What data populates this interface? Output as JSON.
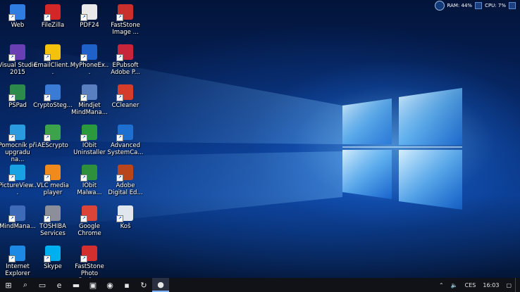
{
  "desktop_icons": [
    {
      "label": "Web",
      "icon": "globe-icon",
      "color": "#2f7de1"
    },
    {
      "label": "FileZilla",
      "icon": "filezilla-icon",
      "color": "#d32626"
    },
    {
      "label": "PDF24",
      "icon": "pdf24-icon",
      "color": "#e9e9e9"
    },
    {
      "label": "FastStone Image ...",
      "icon": "faststone-viewer-icon",
      "color": "#c9302c"
    },
    {
      "label": "Visual Studio 2015",
      "icon": "visual-studio-icon",
      "color": "#6a3fb3"
    },
    {
      "label": "EmailClient...",
      "icon": "star-icon",
      "color": "#f4c20d"
    },
    {
      "label": "MyPhoneEx...",
      "icon": "myphoneexplorer-icon",
      "color": "#1e62c9"
    },
    {
      "label": "EPubsoft Adobe P...",
      "icon": "epubsoft-icon",
      "color": "#c8243a"
    },
    {
      "label": "PSPad",
      "icon": "pspad-icon",
      "color": "#2c8a4a"
    },
    {
      "label": "CryptoSteg...",
      "icon": "undo-arrow-icon",
      "color": "#3a7bd5"
    },
    {
      "label": "Mindjet MindMana...",
      "icon": "mindjet-icon",
      "color": "#5a7fc0"
    },
    {
      "label": "CCleaner",
      "icon": "ccleaner-icon",
      "color": "#d63c2a"
    },
    {
      "label": "Pomocník při upgradu na...",
      "icon": "windows-upgrade-icon",
      "color": "#2b9be0"
    },
    {
      "label": "AEScrypto",
      "icon": "aescrypto-icon",
      "color": "#3ca34a"
    },
    {
      "label": "IObit Uninstaller",
      "icon": "iobit-uninstaller-icon",
      "color": "#2b9a3c"
    },
    {
      "label": "Advanced SystemCa...",
      "icon": "advanced-systemcare-icon",
      "color": "#1f6fd0"
    },
    {
      "label": "PictureView...",
      "icon": "picture-viewer-icon",
      "color": "#19a2e3"
    },
    {
      "label": "VLC media player",
      "icon": "vlc-icon",
      "color": "#f08a1c"
    },
    {
      "label": "IObit Malwa...",
      "icon": "iobit-malware-icon",
      "color": "#2e8f3c"
    },
    {
      "label": "Adobe Digital Ed...",
      "icon": "adobe-digital-editions-icon",
      "color": "#b8451b"
    },
    {
      "label": "MindMana...",
      "icon": "mindmanager-icon",
      "color": "#3e6bb8"
    },
    {
      "label": "TOSHIBA Services",
      "icon": "toshiba-icon",
      "color": "#8a8f99"
    },
    {
      "label": "Google Chrome",
      "icon": "chrome-icon",
      "color": "#db4437"
    },
    {
      "label": "Koš",
      "icon": "recycle-bin-icon",
      "color": "#dfe6ee"
    },
    {
      "label": "Internet Explorer",
      "icon": "internet-explorer-icon",
      "color": "#1e88e5"
    },
    {
      "label": "Skype",
      "icon": "skype-icon",
      "color": "#00aff0"
    },
    {
      "label": "FastStone Photo Resizer",
      "icon": "faststone-resizer-icon",
      "color": "#d32f2f"
    }
  ],
  "tray_widget": {
    "ram_label": "RAM: 44%",
    "cpu_label": "CPU: 7%"
  },
  "taskbar": {
    "items": [
      {
        "name": "start-button",
        "icon": "windows-logo-icon",
        "glyph": "⊞"
      },
      {
        "name": "search-button",
        "icon": "search-icon",
        "glyph": "⌕"
      },
      {
        "name": "task-view-button",
        "icon": "task-view-icon",
        "glyph": "▭"
      },
      {
        "name": "taskbar-edge",
        "icon": "edge-icon",
        "glyph": "e"
      },
      {
        "name": "taskbar-explorer",
        "icon": "folder-icon",
        "glyph": "▬"
      },
      {
        "name": "taskbar-store",
        "icon": "store-icon",
        "glyph": "▣"
      },
      {
        "name": "taskbar-chrome",
        "icon": "chrome-icon",
        "glyph": "◉"
      },
      {
        "name": "taskbar-app-blue",
        "icon": "app-window-icon",
        "glyph": "▪"
      },
      {
        "name": "taskbar-app-refresh",
        "icon": "refresh-icon",
        "glyph": "↻"
      },
      {
        "name": "taskbar-app-active",
        "icon": "app-circle-icon",
        "glyph": "●"
      }
    ],
    "tray": {
      "language": "CES",
      "time": "16:03"
    }
  }
}
